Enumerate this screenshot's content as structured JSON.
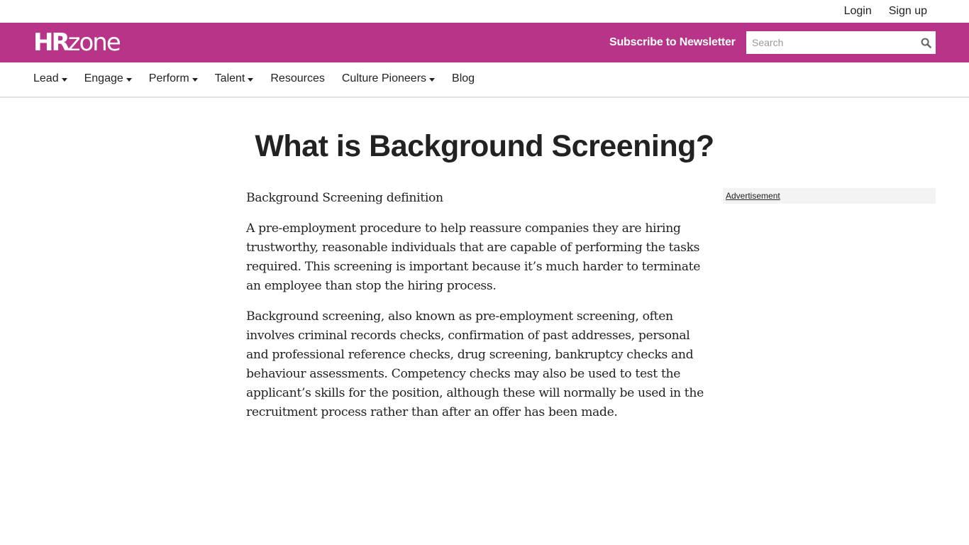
{
  "topbar": {
    "login": "Login",
    "signup": "Sign up"
  },
  "brand": {
    "logo_hr": "HR",
    "logo_zone": "zone",
    "accent_color": "#b73488",
    "subscribe": "Subscribe to Newsletter",
    "search": {
      "placeholder": "Search",
      "value": "",
      "icon": "search-icon"
    }
  },
  "nav": {
    "items": [
      {
        "label": "Lead",
        "dropdown": true
      },
      {
        "label": "Engage",
        "dropdown": true
      },
      {
        "label": "Perform",
        "dropdown": true
      },
      {
        "label": "Talent",
        "dropdown": true
      },
      {
        "label": "Resources",
        "dropdown": false
      },
      {
        "label": "Culture Pioneers",
        "dropdown": true
      },
      {
        "label": "Blog",
        "dropdown": false
      }
    ]
  },
  "article": {
    "title": "What is Background Screening?",
    "paragraphs": [
      "Background Screening definition",
      "A pre-employment procedure to help reassure companies they are hiring trustworthy, reasonable individuals that are capable of performing the tasks required. This screening is important because it’s much harder to terminate an employee than stop the hiring process.",
      "Background screening, also known as pre-employment screening, often involves criminal records checks, confirmation of past addresses, personal and professional reference checks, drug screening, bankruptcy checks and behaviour assessments. Competency checks may also be used to test the applicant’s skills for the position, although these will normally be used in the recruitment process rather than after an offer has been made."
    ]
  },
  "sidebar": {
    "ad_label": "Advertisement"
  }
}
